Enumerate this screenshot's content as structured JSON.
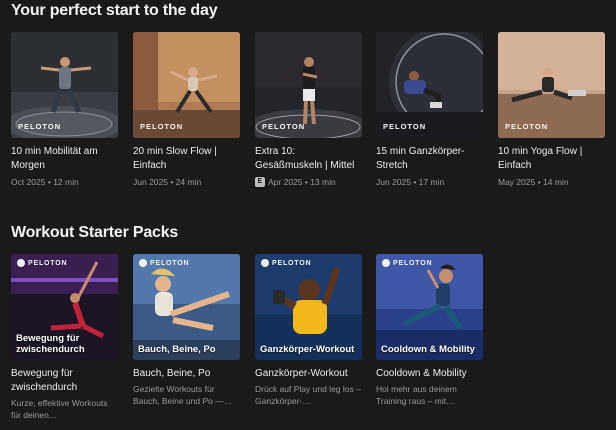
{
  "sections": [
    {
      "title": "Your perfect start to the day",
      "cards": [
        {
          "watermark": "PELOTON",
          "title": "10 min Mobilität am Morgen",
          "meta": "Oct 2025 • 12 min",
          "badge": ""
        },
        {
          "watermark": "PELOTON",
          "title": "20 min Slow Flow | Einfach",
          "meta": "Jun 2025 • 24 min",
          "badge": ""
        },
        {
          "watermark": "PELOTON",
          "title": "Extra 10: Gesäßmuskeln | Mittel",
          "meta": "Apr 2025 • 13 min",
          "badge": "E"
        },
        {
          "watermark": "PELOTON",
          "title": "15 min Ganzkörper-Stretch",
          "meta": "Jun 2025 • 17 min",
          "badge": ""
        },
        {
          "watermark": "PELOTON",
          "title": "10 min Yoga Flow | Einfach",
          "meta": "May 2025 • 14 min",
          "badge": ""
        }
      ]
    },
    {
      "title": "Workout Starter Packs",
      "packs": [
        {
          "brand": "PELOTON",
          "overlay": "Bewegung für zwischendurch",
          "title": "Bewegung für zwischendurch",
          "desc": "Kurze, effektive Workouts für deinen…"
        },
        {
          "brand": "PELOTON",
          "overlay": "Bauch, Beine, Po",
          "title": "Bauch, Beine, Po",
          "desc": "Gezielte Workouts für Bauch, Beine und Po —…"
        },
        {
          "brand": "PELOTON",
          "overlay": "Ganzkörper-Workout",
          "title": "Ganzkörper-Workout",
          "desc": "Drück auf Play und leg los – Ganzkörper-…"
        },
        {
          "brand": "PELOTON",
          "overlay": "Cooldown & Mobility",
          "title": "Cooldown & Mobility",
          "desc": "Hol mehr aus deinem Training raus – mit…"
        }
      ]
    }
  ],
  "colors": {
    "background": "#1a1a1a",
    "text": "#ececec",
    "muted": "#9a9a9a"
  }
}
